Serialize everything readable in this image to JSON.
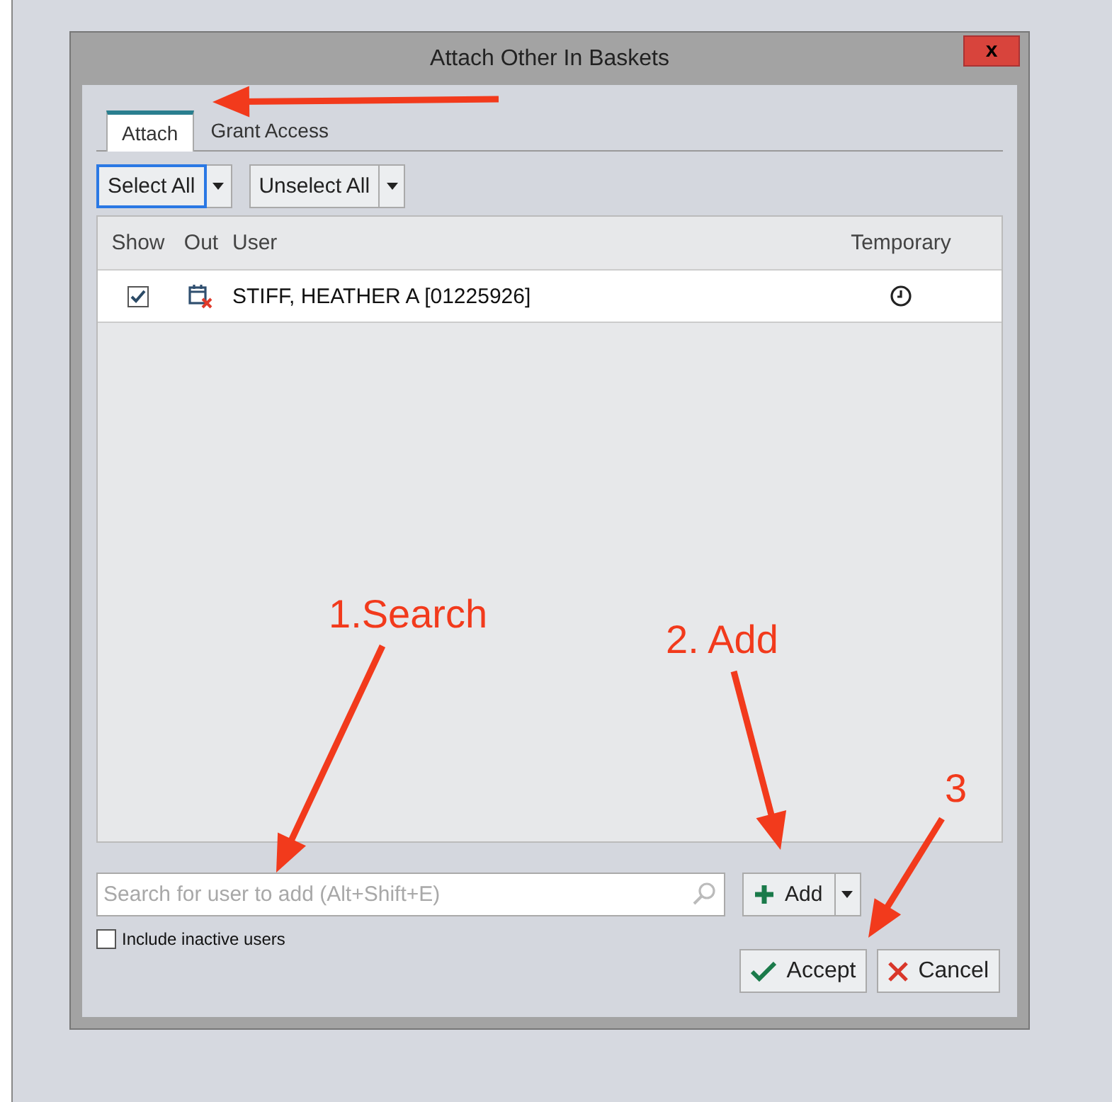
{
  "window": {
    "title": "Attach Other In Baskets",
    "close": "x"
  },
  "tabs": [
    {
      "label": "Attach",
      "selected": true
    },
    {
      "label": "Grant Access",
      "selected": false
    }
  ],
  "toolbar": [
    {
      "label": "Select All",
      "focused": true
    },
    {
      "label": "Unselect All",
      "focused": false
    }
  ],
  "table": {
    "columns": [
      "Show",
      "Out",
      "User",
      "Temporary"
    ],
    "rows": [
      {
        "show": true,
        "out": true,
        "user": "STIFF, HEATHER A [01225926]",
        "temporary": true
      }
    ]
  },
  "search": {
    "placeholder": "Search for user to add (Alt+Shift+E)"
  },
  "add_button": "Add",
  "include_inactive": {
    "label": "Include inactive users",
    "checked": false
  },
  "buttons": [
    {
      "kind": "accept",
      "label": "Accept"
    },
    {
      "kind": "cancel",
      "label": "Cancel"
    }
  ],
  "annotations": [
    {
      "text": "1.Search"
    },
    {
      "text": "2. Add"
    },
    {
      "text": "3"
    }
  ]
}
